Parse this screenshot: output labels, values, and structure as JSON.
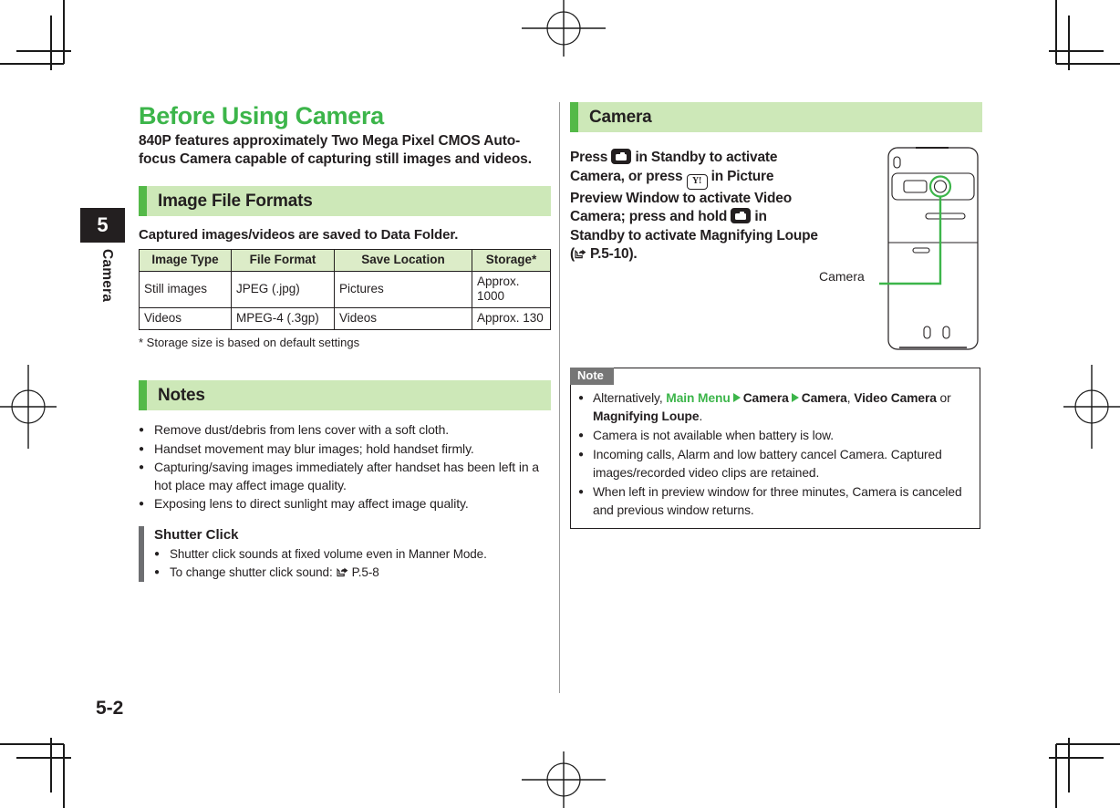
{
  "page": {
    "number": "5-2",
    "chapter_number": "5",
    "chapter_name": "Camera"
  },
  "left_column": {
    "title": "Before Using Camera",
    "lead": "840P features approximately Two Mega Pixel CMOS Auto-focus Camera capable of capturing still images and videos.",
    "section_image_file_formats": {
      "heading": "Image File Formats",
      "subhead": "Captured images/videos are saved to Data Folder.",
      "table": {
        "columns": [
          "Image Type",
          "File Format",
          "Save Location",
          "Storage*"
        ],
        "rows": [
          [
            "Still images",
            "JPEG (.jpg)",
            "Pictures",
            "Approx. 1000"
          ],
          [
            "Videos",
            "MPEG-4 (.3gp)",
            "Videos",
            "Approx. 130"
          ]
        ],
        "footnote": "* Storage size is based on default settings"
      }
    },
    "section_notes": {
      "heading": "Notes",
      "bullets": [
        "Remove dust/debris from lens cover with a soft cloth.",
        "Handset movement may blur images; hold handset firmly.",
        "Capturing/saving images immediately after handset has been left in a hot place may affect image quality.",
        "Exposing lens to direct sunlight may affect image quality."
      ],
      "shutter_click": {
        "title": "Shutter Click",
        "bullets": [
          "Shutter click sounds at fixed volume even in Manner Mode.",
          "To change shutter click sound:"
        ],
        "reference": "P.5-8"
      }
    }
  },
  "right_column": {
    "section_camera": {
      "heading": "Camera",
      "intro_part_1": "Press",
      "intro_part_2": "in Standby to activate Camera, or press",
      "intro_part_3": "in Picture Preview Window to activate Video Camera; press and hold",
      "intro_part_4": "in Standby to activate Magnifying Loupe (",
      "intro_reference": "P.5-10",
      "intro_part_5": ").",
      "key_camera_label": "camera-key",
      "key_yahoo_label": "Y!"
    },
    "figure": {
      "callout_label": "Camera"
    },
    "note_box": {
      "label": "Note",
      "bullets": [
        {
          "segments": [
            {
              "text": "Alternatively, ",
              "style": "normal"
            },
            {
              "text": "Main Menu",
              "style": "green-bold"
            },
            {
              "text": "arrow",
              "style": "arrow"
            },
            {
              "text": "Camera",
              "style": "bold"
            },
            {
              "text": "arrow",
              "style": "arrow"
            },
            {
              "text": "Camera",
              "style": "bold"
            },
            {
              "text": ", ",
              "style": "normal"
            },
            {
              "text": "Video Camera",
              "style": "bold"
            },
            {
              "text": " or ",
              "style": "normal"
            },
            {
              "text": "Magnifying Loupe",
              "style": "bold"
            },
            {
              "text": ".",
              "style": "normal"
            }
          ]
        },
        {
          "text": "Camera is not available when battery is low."
        },
        {
          "text": "Incoming calls, Alarm and low battery cancel Camera. Captured images/recorded video clips are retained."
        },
        {
          "text": "When left in preview window for three minutes, Camera is canceled and previous window returns."
        }
      ]
    }
  },
  "colors": {
    "brand_green": "#3cb54a",
    "bar_green": "#54b948",
    "bar_bg_green": "#cde8b8",
    "table_header_green": "#dcecc8",
    "note_gray": "#767676",
    "text": "#231f20"
  }
}
